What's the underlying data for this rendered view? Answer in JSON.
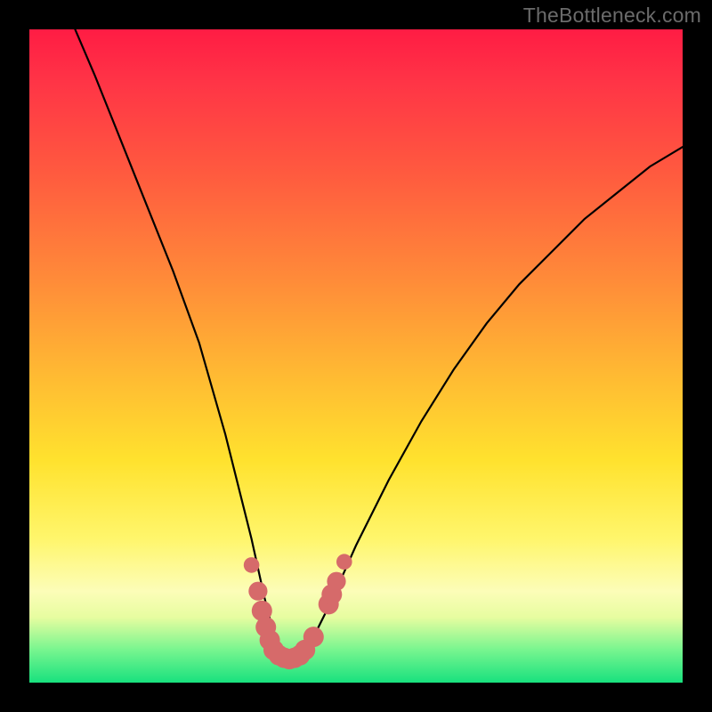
{
  "watermark": {
    "text": "TheBottleneck.com"
  },
  "chart_data": {
    "type": "line",
    "title": "",
    "xlabel": "",
    "ylabel": "",
    "xlim": [
      0,
      100
    ],
    "ylim": [
      0,
      100
    ],
    "series": [
      {
        "name": "curve",
        "x": [
          7,
          10,
          14,
          18,
          22,
          26,
          30,
          32,
          34,
          36,
          37,
          38,
          39,
          40,
          41,
          42,
          44,
          46,
          50,
          55,
          60,
          65,
          70,
          75,
          80,
          85,
          90,
          95,
          100
        ],
        "y": [
          100,
          93,
          83,
          73,
          63,
          52,
          38,
          30,
          22,
          13,
          9,
          6,
          4,
          4,
          4,
          5,
          8,
          12,
          21,
          31,
          40,
          48,
          55,
          61,
          66,
          71,
          75,
          79,
          82
        ]
      }
    ],
    "markers": {
      "name": "valley-dots",
      "color": "#d66a6a",
      "points": [
        {
          "x": 34.0,
          "y": 18.0,
          "r": 1.0
        },
        {
          "x": 35.0,
          "y": 14.0,
          "r": 1.2
        },
        {
          "x": 35.6,
          "y": 11.0,
          "r": 1.3
        },
        {
          "x": 36.2,
          "y": 8.5,
          "r": 1.3
        },
        {
          "x": 36.8,
          "y": 6.5,
          "r": 1.3
        },
        {
          "x": 37.4,
          "y": 5.0,
          "r": 1.3
        },
        {
          "x": 38.2,
          "y": 4.2,
          "r": 1.3
        },
        {
          "x": 39.0,
          "y": 3.8,
          "r": 1.3
        },
        {
          "x": 39.8,
          "y": 3.6,
          "r": 1.3
        },
        {
          "x": 40.6,
          "y": 3.8,
          "r": 1.3
        },
        {
          "x": 41.4,
          "y": 4.2,
          "r": 1.3
        },
        {
          "x": 42.2,
          "y": 5.0,
          "r": 1.3
        },
        {
          "x": 43.5,
          "y": 7.0,
          "r": 1.3
        },
        {
          "x": 45.8,
          "y": 12.0,
          "r": 1.3
        },
        {
          "x": 46.3,
          "y": 13.5,
          "r": 1.3
        },
        {
          "x": 47.0,
          "y": 15.5,
          "r": 1.2
        },
        {
          "x": 48.2,
          "y": 18.5,
          "r": 1.0
        }
      ]
    }
  }
}
